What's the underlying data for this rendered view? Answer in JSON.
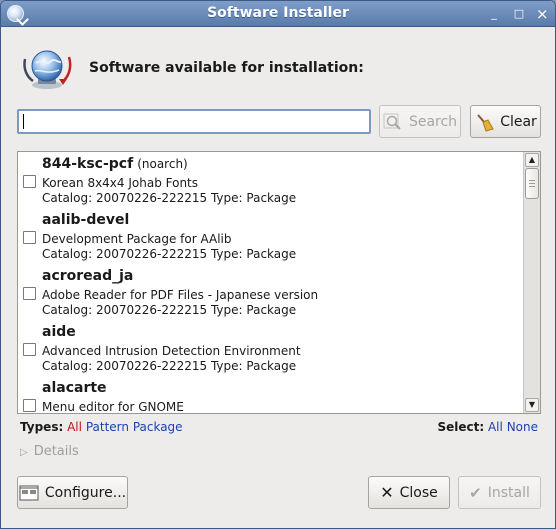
{
  "window": {
    "title": "Software Installer",
    "minimize": "_",
    "maximize": "□",
    "close": "×"
  },
  "header": {
    "text": "Software available for installation:",
    "icon": "globe-install-icon"
  },
  "search": {
    "value": "",
    "placeholder": "",
    "search_label": "Search",
    "clear_label": "Clear"
  },
  "packages": [
    {
      "name": "844-ksc-pcf",
      "arch": "(noarch)",
      "description": "Korean 8x4x4 Johab Fonts",
      "catalog": "Catalog: 20070226-222215 Type: Package",
      "checked": false
    },
    {
      "name": "aalib-devel",
      "arch": "",
      "description": "Development Package for AAlib",
      "catalog": "Catalog: 20070226-222215 Type: Package",
      "checked": false
    },
    {
      "name": "acroread_ja",
      "arch": "",
      "description": "Adobe Reader for PDF Files - Japanese version",
      "catalog": "Catalog: 20070226-222215 Type: Package",
      "checked": false
    },
    {
      "name": "aide",
      "arch": "",
      "description": "Advanced Intrusion Detection Environment",
      "catalog": "Catalog: 20070226-222215 Type: Package",
      "checked": false
    },
    {
      "name": "alacarte",
      "arch": "",
      "description": "Menu editor for GNOME",
      "catalog": "",
      "checked": false
    }
  ],
  "filters": {
    "types_label": "Types:",
    "types": [
      "All",
      "Pattern",
      "Package"
    ],
    "select_label": "Select:",
    "select": [
      "All",
      "None"
    ]
  },
  "details_label": "Details",
  "footer": {
    "configure_label": "Configure...",
    "close_label": "Close",
    "install_label": "Install"
  },
  "colors": {
    "titlebar": "#6a8bbb",
    "link_active": "#c4111b",
    "link": "#1d3fb3"
  }
}
